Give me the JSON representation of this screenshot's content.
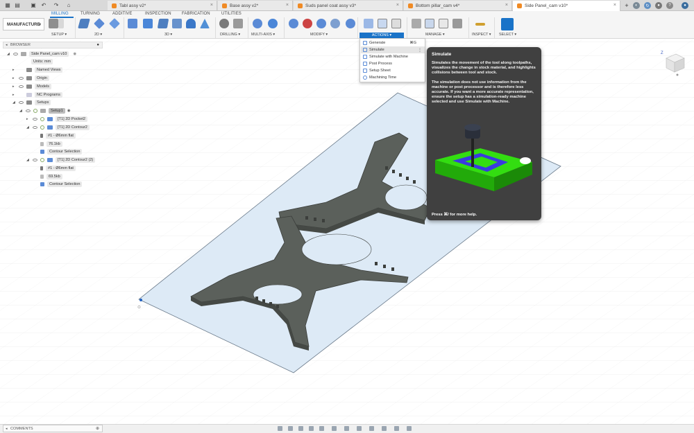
{
  "window": {
    "doc_tabs": [
      {
        "label": "Tabl assy v2*",
        "active": false
      },
      {
        "label": "Base assy v2*",
        "active": false
      },
      {
        "label": "Suds panel coat assy v3*",
        "active": false
      },
      {
        "label": "Bottom pillar_cam v4*",
        "active": false
      },
      {
        "label": "Side Panel_cam v10*",
        "active": true
      }
    ]
  },
  "toolbar": {
    "workspace": "MANUFACTURE",
    "menu_tabs": [
      "MILLING",
      "TURNING",
      "ADDITIVE",
      "INSPECTION",
      "FABRICATION",
      "UTILITIES"
    ],
    "groups": [
      {
        "label": "SETUP ▾"
      },
      {
        "label": "2D ▾"
      },
      {
        "label": "3D ▾"
      },
      {
        "label": "DRILLING ▾"
      },
      {
        "label": "MULTI-AXIS ▾"
      },
      {
        "label": "MODIFY ▾"
      },
      {
        "label": "ACTIONS ▾"
      },
      {
        "label": "MANAGE ▾"
      },
      {
        "label": "INSPECT ▾"
      },
      {
        "label": "SELECT ▾"
      }
    ]
  },
  "actions_menu": {
    "items": [
      {
        "label": "Generate",
        "shortcut": "⌘G"
      },
      {
        "label": "Simulate",
        "shortcut": ""
      },
      {
        "label": "Simulate with Machine",
        "shortcut": ""
      },
      {
        "label": "Post Process",
        "shortcut": ""
      },
      {
        "label": "Setup Sheet",
        "shortcut": ""
      },
      {
        "label": "Machining Time",
        "shortcut": ""
      }
    ],
    "highlighted": "Simulate"
  },
  "tooltip": {
    "title": "Simulate",
    "p1": "Simulates the movement of the tool along toolpaths, visualizes the change in stock material, and highlights collisions between tool and stock.",
    "p2": "The simulation does not use information from the machine or post processor and is therefore less accurate. If you want a more accurate representation, ensure the setup has a simulation-ready machine selected and use Simulate with Machine.",
    "help": "Press ⌘/ for more help."
  },
  "browser": {
    "header": "BROWSER",
    "rows": [
      {
        "label": "Side Panel_cam v10",
        "indent": 0
      },
      {
        "label": "Units: mm",
        "indent": 1
      },
      {
        "label": "Named Views",
        "indent": 1
      },
      {
        "label": "Origin",
        "indent": 1
      },
      {
        "label": "Models",
        "indent": 1
      },
      {
        "label": "NC Programs",
        "indent": 1
      },
      {
        "label": "Setups",
        "indent": 1
      },
      {
        "label": "Setup1",
        "indent": 2
      },
      {
        "label": "[T1] 2D Pocket2",
        "indent": 3
      },
      {
        "label": "[T1] 2D Contour2",
        "indent": 3
      },
      {
        "label": "#1 - Ø6mm flat",
        "indent": 4
      },
      {
        "label": "76.1kb",
        "indent": 4
      },
      {
        "label": "Contour Selection",
        "indent": 4
      },
      {
        "label": "[T1] 2D Contour2 (2)",
        "indent": 3
      },
      {
        "label": "#1 - Ø6mm flat",
        "indent": 4
      },
      {
        "label": "69.5kb",
        "indent": 4
      },
      {
        "label": "Contour Selection",
        "indent": 4
      }
    ]
  },
  "comments": {
    "label": "COMMENTS"
  },
  "colors": {
    "accent": "#1a73c8",
    "stock": "#5b605b",
    "tool_green": "#33dd11",
    "tooltip_bg": "#404040"
  }
}
